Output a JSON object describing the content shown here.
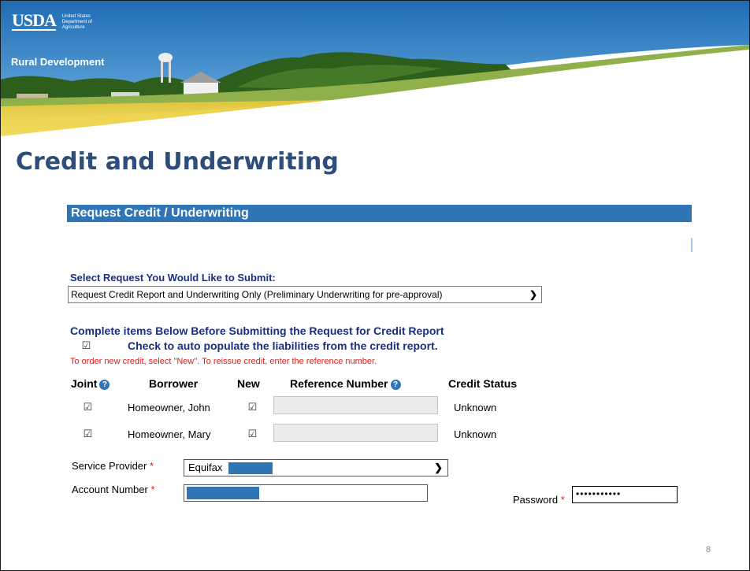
{
  "banner": {
    "logo_text": "USDA",
    "logo_sub_lines": [
      "United States",
      "Department of",
      "Agriculture"
    ],
    "agency": "Rural Development"
  },
  "slide_title": "Credit and Underwriting",
  "panel": {
    "header": "Request Credit / Underwriting",
    "select_label": "Select Request You Would Like to Submit:",
    "select_value": "Request Credit Report and Underwriting Only (Preliminary Underwriting for pre-approval)",
    "complete_label": "Complete items Below Before Submitting the Request for Credit Report",
    "autopopulate_label": "Check to auto populate the liabilities from the credit report.",
    "autopopulate_checked": true,
    "note": "To order new credit, select \"New\". To reissue credit, enter the reference number."
  },
  "table": {
    "headers": {
      "joint": "Joint",
      "borrower": "Borrower",
      "new": "New",
      "reference": "Reference Number",
      "status": "Credit Status"
    },
    "rows": [
      {
        "joint": true,
        "borrower": "Homeowner, John",
        "new": true,
        "reference": "",
        "status": "Unknown"
      },
      {
        "joint": true,
        "borrower": "Homeowner, Mary",
        "new": true,
        "reference": "",
        "status": "Unknown"
      }
    ]
  },
  "form": {
    "service_provider_label": "Service Provider",
    "service_provider_value": "Equifax",
    "account_number_label": "Account Number",
    "password_label": "Password",
    "password_mask": "•••••••••••",
    "required_marker": "*"
  },
  "page_number": "8",
  "colors": {
    "title_blue": "#2e4d7b",
    "header_blue": "#2f74b5",
    "label_blue": "#1a2f80",
    "required_red": "#e51a1a"
  }
}
